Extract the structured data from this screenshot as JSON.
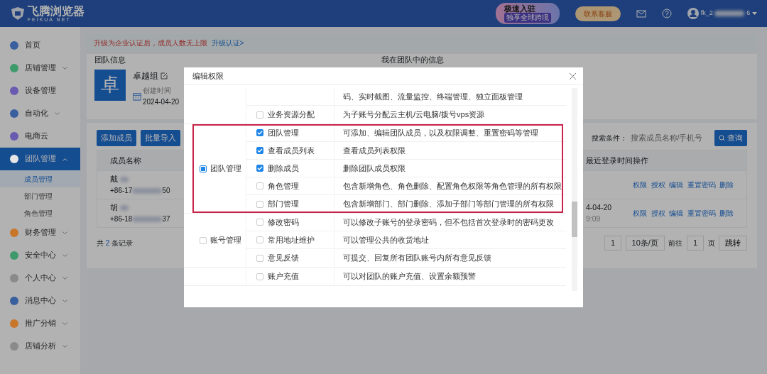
{
  "header": {
    "logo_title": "飞腾浏览器",
    "logo_subtitle": "FEIKUA NET",
    "promo_title": "极速入驻",
    "promo_subtitle": "独享全球跨境",
    "contact_button": "联系客服",
    "user_prefix": "fk_2",
    "user_suffix": "6"
  },
  "sidebar": {
    "items": [
      {
        "label": "首页",
        "color": "#3a5f9e",
        "selected": false
      },
      {
        "label": "店铺管理",
        "color": "#3e9a6a",
        "selected": false,
        "expanded": false
      },
      {
        "label": "设备管理",
        "color": "#6a5ab0",
        "selected": false
      },
      {
        "label": "自动化",
        "color": "#3a5f9e",
        "selected": false,
        "expanded": false
      },
      {
        "label": "电商云",
        "color": "#6a5ab0",
        "selected": false
      },
      {
        "label": "团队管理",
        "color": "#e6e6e6",
        "selected": true,
        "expanded": true,
        "children": [
          {
            "label": "成员管理",
            "selected": true
          },
          {
            "label": "部门管理",
            "selected": false
          },
          {
            "label": "角色管理",
            "selected": false
          }
        ]
      },
      {
        "label": "财务管理",
        "color": "#c8762a",
        "selected": false,
        "expanded": false
      },
      {
        "label": "安全中心",
        "color": "#3e9a6a",
        "selected": false,
        "expanded": false
      },
      {
        "label": "个人中心",
        "color": "#8a8a8a",
        "selected": false,
        "expanded": false
      },
      {
        "label": "消息中心",
        "color": "#3a5f9e",
        "selected": false,
        "expanded": false
      },
      {
        "label": "推广分销",
        "color": "#c8762a",
        "selected": false,
        "expanded": false
      },
      {
        "label": "店铺分析",
        "color": "#8a8a8a",
        "selected": false,
        "expanded": false
      }
    ]
  },
  "notice": {
    "text": "升级为企业认证后，成员人数无上限",
    "link": "升级认证>"
  },
  "team_info": {
    "title": "团队信息",
    "avatar": "卓",
    "name": "卓越组",
    "created_label": "创建时间",
    "created_date": "2024-04-20"
  },
  "my_info": {
    "title": "我在团队中的信息"
  },
  "toolbar": {
    "buttons": [
      "添加成员",
      "批量导入"
    ],
    "search_label": "搜索条件：",
    "search_placeholder": "搜索成员名称/手机号",
    "query_button": "查询"
  },
  "table": {
    "columns": [
      "成员名称",
      "最近登录时间",
      "操作"
    ],
    "rows": [
      {
        "name": "戴",
        "phone_prefix": "+86-17",
        "phone_suffix": "50",
        "actions": [
          "权限",
          "授权",
          "编辑",
          "重置密码",
          "删除"
        ]
      },
      {
        "name": "胡",
        "phone_prefix": "+86-18",
        "phone_suffix": "37",
        "login_date": "4-04-20",
        "login_time": "9:09",
        "actions": [
          "权限",
          "授权",
          "编辑",
          "重置密码",
          "删除"
        ]
      }
    ]
  },
  "total": {
    "prefix": "共",
    "count": "2",
    "suffix": "条记录"
  },
  "pagination": {
    "page": "1",
    "page_size": "10条/页",
    "goto_label": "前往",
    "goto_value": "1",
    "page_unit": "页",
    "jump_button": "跳转"
  },
  "modal": {
    "title": "编辑权限",
    "groups": [
      {
        "highlighted": false,
        "permissions": [
          {
            "description": "码、实时截图、流量监控、终端管理、独立面板管理"
          },
          {
            "name": "业务资源分配",
            "checked": false,
            "description": "为子账号分配云主机/云电脑/拨号vps资源"
          }
        ]
      },
      {
        "label": "团队管理",
        "checked": false,
        "indeterminate": true,
        "highlighted": true,
        "permissions": [
          {
            "name": "团队管理",
            "checked": true,
            "description": "可添加、编辑团队成员，以及权限调整、重置密码等管理"
          },
          {
            "name": "查看成员列表",
            "checked": true,
            "description": "查看成员列表权限"
          },
          {
            "name": "删除成员",
            "checked": true,
            "description": "删除团队成员权限"
          },
          {
            "name": "角色管理",
            "checked": false,
            "description": "包含新增角色、角色删除、配置角色权限等角色管理的所有权限"
          },
          {
            "name": "部门管理",
            "checked": false,
            "description": "包含新增部门、部门删除、添加子部门等部门管理的所有权限"
          }
        ]
      },
      {
        "label": "账号管理",
        "checked": false,
        "indeterminate": false,
        "highlighted": false,
        "permissions": [
          {
            "name": "修改密码",
            "checked": false,
            "description": "可以修改子账号的登录密码，但不包括首次登录时的密码更改"
          },
          {
            "name": "常用地址维护",
            "checked": false,
            "description": "可以管理公共的收货地址"
          },
          {
            "name": "意见反馈",
            "checked": false,
            "description": "可提交、回复所有团队账号内所有意见反馈"
          }
        ]
      },
      {
        "highlighted": false,
        "permissions": [
          {
            "name": "账户充值",
            "checked": false,
            "description": "可以对团队的账户充值、设置余额预警"
          }
        ]
      }
    ]
  }
}
